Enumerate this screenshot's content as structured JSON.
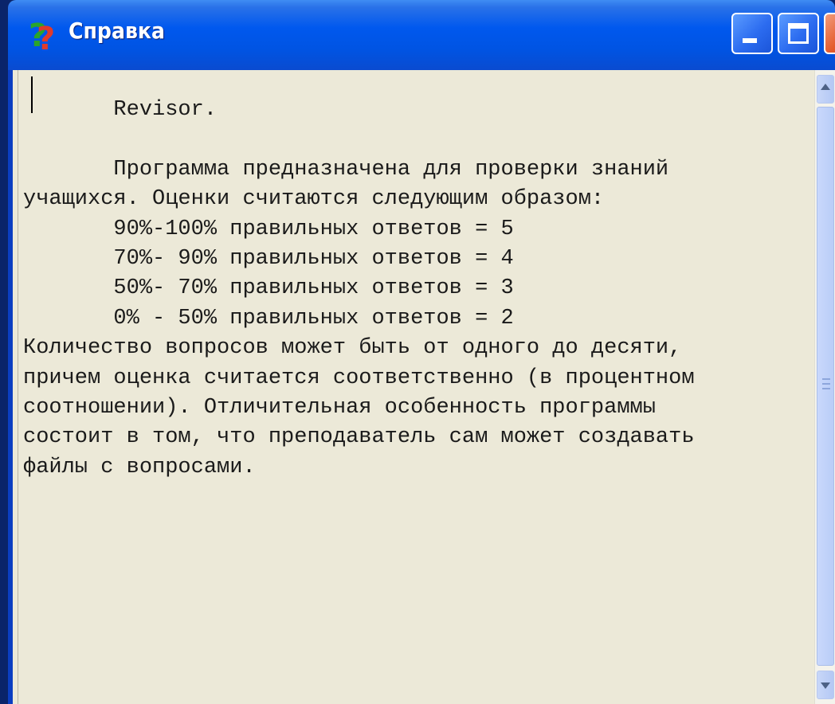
{
  "window": {
    "title": "Справка",
    "app_icon": "help-question-icon",
    "controls": [
      "minimize-icon",
      "maximize-icon",
      "close-icon"
    ],
    "accent_color": "#0054e3",
    "close_color": "#e45a2c"
  },
  "content": {
    "text": "       Revisor.\n\n       Программа предназначена для проверки знаний\nучащихся. Оценки считаются следующим образом:\n       90%-100% правильных ответов = 5\n       70%- 90% правильных ответов = 4\n       50%- 70% правильных ответов = 3\n       0% - 50% правильных ответов = 2\nКоличество вопросов может быть от одного до десяти,\nпричем оценка считается соответственно (в процентном\nсоотношении). Отличительная особенность программы\nсостоит в том, что преподаватель сам может создавать\nфайлы с вопросами."
  }
}
